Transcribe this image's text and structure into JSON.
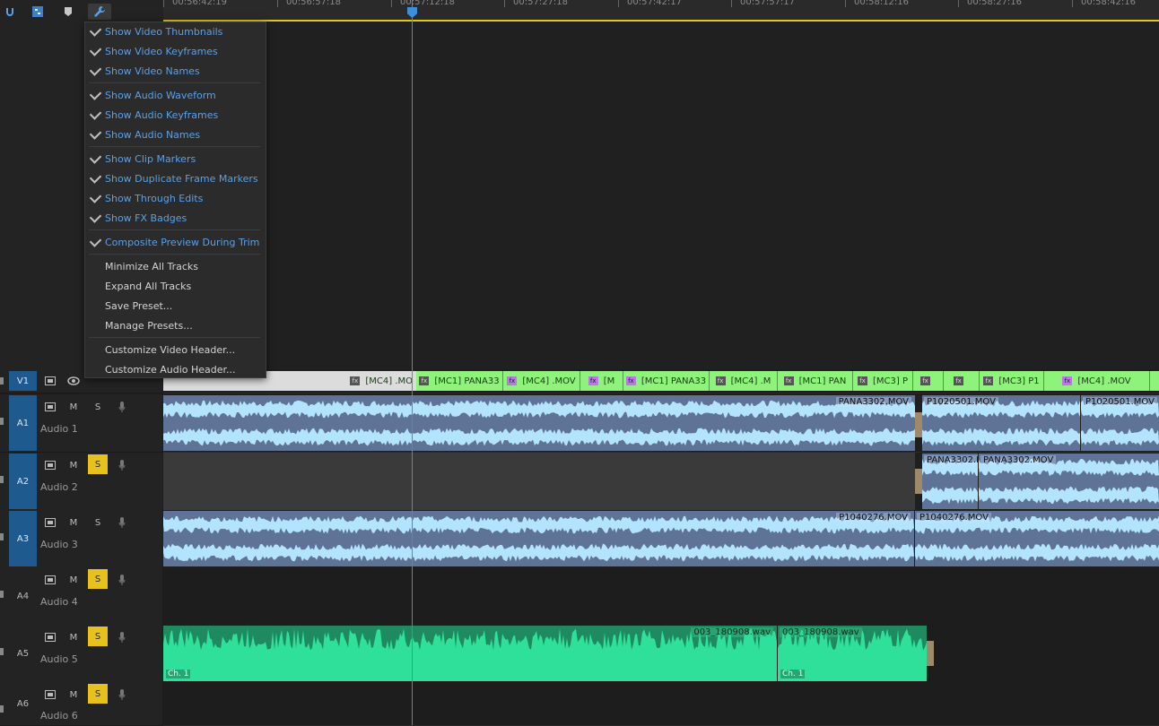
{
  "ruler": {
    "timecodes": [
      "00:56:42:19",
      "00:56:57:18",
      "00:57:12:18",
      "00:57:27:18",
      "00:57:42:17",
      "00:57:57:17",
      "00:58:12:16",
      "00:58:27:16",
      "00:58:42:16"
    ]
  },
  "menu": {
    "group1": [
      "Show Video Thumbnails",
      "Show Video Keyframes",
      "Show Video Names"
    ],
    "group2": [
      "Show Audio Waveform",
      "Show Audio Keyframes",
      "Show Audio Names"
    ],
    "group3": [
      "Show Clip Markers",
      "Show Duplicate Frame Markers",
      "Show Through Edits",
      "Show FX Badges"
    ],
    "group4": [
      "Composite Preview During Trim"
    ],
    "group5": [
      "Minimize All Tracks",
      "Expand All Tracks",
      "Save Preset...",
      "Manage Presets..."
    ],
    "group6": [
      "Customize Video Header...",
      "Customize Audio Header..."
    ]
  },
  "tracks": {
    "v1": {
      "id": "V1"
    },
    "audio": [
      {
        "id": "A1",
        "name": "Audio 1",
        "m": "M",
        "s": "S"
      },
      {
        "id": "A2",
        "name": "Audio 2",
        "m": "M",
        "s": "S"
      },
      {
        "id": "A3",
        "name": "Audio 3",
        "m": "M",
        "s": "S"
      },
      {
        "id": "A4",
        "name": "Audio 4",
        "m": "M",
        "s": "S"
      },
      {
        "id": "A5",
        "name": "Audio 5",
        "m": "M",
        "s": "S"
      },
      {
        "id": "A6",
        "name": "Audio 6",
        "m": "M",
        "s": "S"
      }
    ]
  },
  "video_clips": [
    "[MC4] .MO",
    "[MC1] PANA33",
    "[MC4] .MOV",
    "[M",
    "[MC1] PANA33",
    "[MC4] .M",
    "[MC1] PAN",
    "[MC3] P",
    "",
    "",
    "[MC3] P1",
    "[MC4] .MOV"
  ],
  "audio_clips": {
    "a1": [
      "PANA3302.MOV",
      "P1020501.MOV",
      "P1020501.MOV"
    ],
    "a2": [
      "PANA3302.M",
      "PANA3302.MOV"
    ],
    "a3": [
      "P1040276.MOV",
      "P1040276.MOV"
    ],
    "a5": [
      "003_180908.wav",
      "003_180908.wav"
    ],
    "a5_channel": [
      "Ch. 1",
      "Ch. 1"
    ]
  },
  "colors": {
    "accent": "#3f8fd8",
    "solo": "#e8c11a",
    "video_clip": "#8ef37a",
    "audio_clip": "#5e7396",
    "wave": "#b3e4ff",
    "audio_green": "#1f8a5f",
    "wave_green": "#2fe09a"
  }
}
